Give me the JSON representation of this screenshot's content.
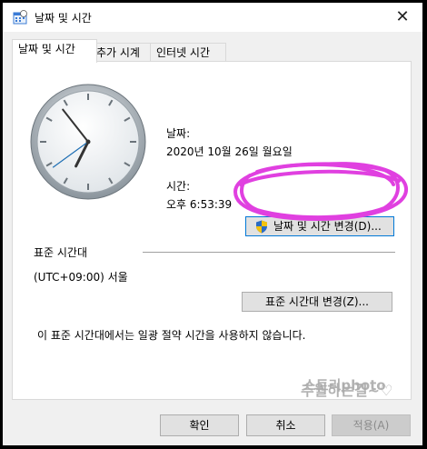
{
  "window": {
    "title": "날짜 및 시간",
    "close_glyph": "✕"
  },
  "tabs": [
    {
      "label": "날짜 및 시간",
      "active": true
    },
    {
      "label": "추가 시계",
      "active": false
    },
    {
      "label": "인터넷 시간",
      "active": false
    }
  ],
  "date": {
    "label": "날짜:",
    "value": "2020년 10월 26일 월요일"
  },
  "time": {
    "label": "시간:",
    "value": "오후 6:53:39"
  },
  "change_datetime_button": "날짜 및 시간 변경(D)...",
  "timezone": {
    "header": "표준 시간대",
    "value": "(UTC+09:00) 서울",
    "change_button": "표준 시간대 변경(Z)..."
  },
  "dst_notice": "이 표준 시간대에서는 일광 절약 시간을 사용하지 않습니다.",
  "footer": {
    "ok": "확인",
    "cancel": "취소",
    "apply": "적용(A)"
  },
  "watermark": {
    "line1": "스토리photo",
    "line2": "추월하는길~♡"
  },
  "colors": {
    "scribble": "#e040e0",
    "focus_border": "#0078d7",
    "shield_blue": "#2b6cc4",
    "shield_yellow": "#f3c20c"
  },
  "icons": {
    "title": "clock-calendar-icon",
    "shield": "uac-shield-icon",
    "close": "close-icon"
  },
  "clock_time": {
    "hours": 6,
    "minutes": 53,
    "seconds": 39
  }
}
